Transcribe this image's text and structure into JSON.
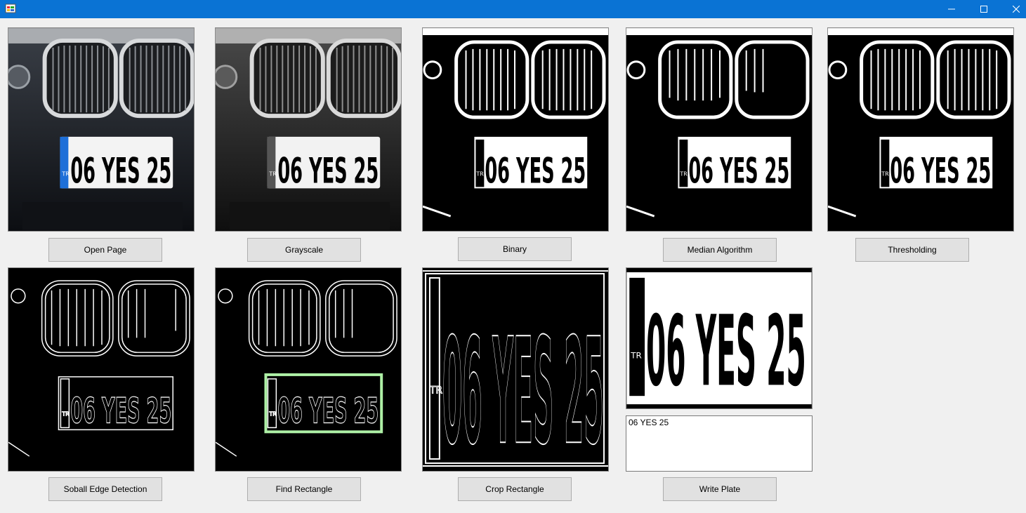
{
  "window": {
    "title_bar_color": "#0a73d4",
    "controls": [
      "minimize-icon",
      "maximize-icon",
      "close-icon"
    ]
  },
  "plate_text": "06 YES 25",
  "plate_country": "TR",
  "stages": {
    "open_page": "Open Page",
    "grayscale": "Grayscale",
    "binary": "Binary",
    "median": "Median Algorithm",
    "thresholding": "Thresholding",
    "sobel": "Soball Edge Detection",
    "find_rectangle": "Find Rectangle",
    "crop_rectangle": "Crop Rectangle",
    "write_plate": "Write Plate"
  },
  "output": {
    "recognized_text": "06 YES 25"
  },
  "colors": {
    "plate_band_blue": "#1e6fd8",
    "detection_box_green": "#aef0a6"
  }
}
